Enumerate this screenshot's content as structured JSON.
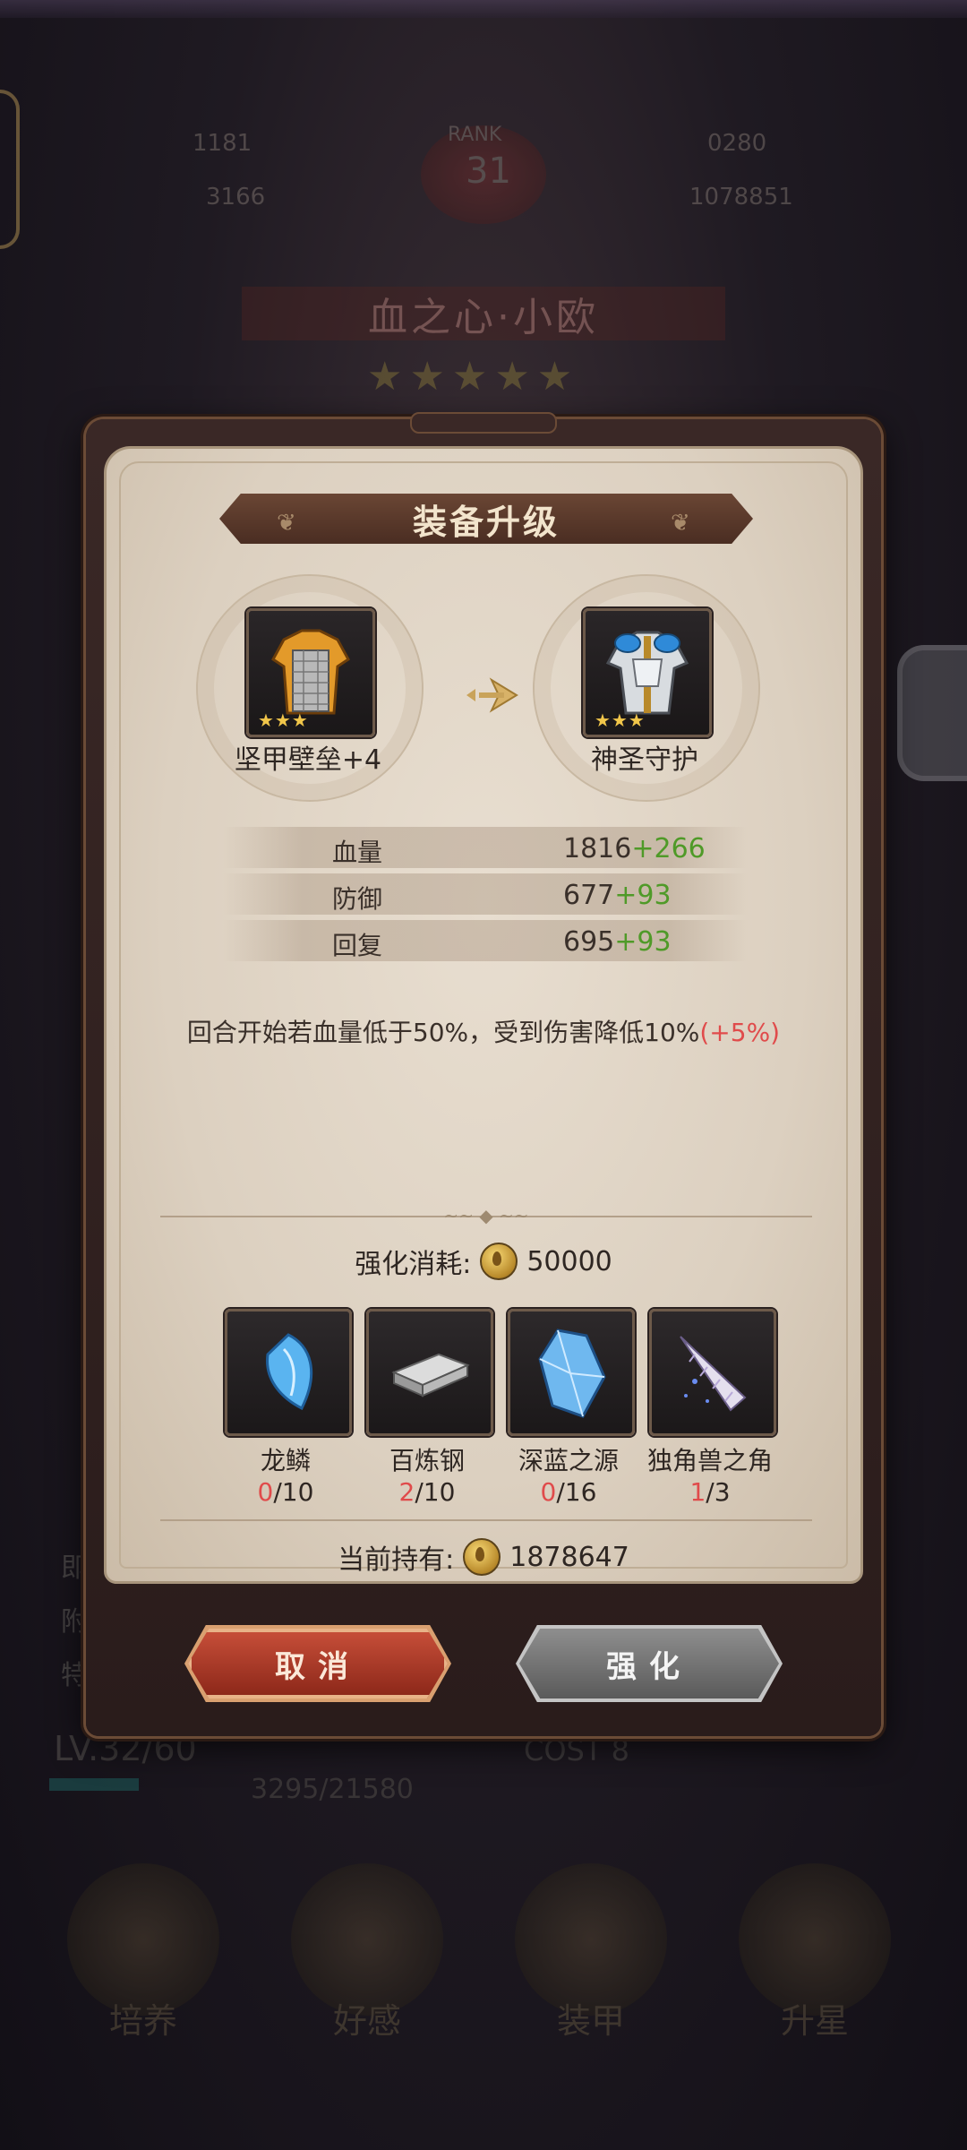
{
  "background": {
    "header_stats": [
      "1181",
      "RANK",
      "31",
      "0280",
      "3166",
      "1078851"
    ],
    "hero_name": "血之心·小欧",
    "hero_level": "LV.32/60",
    "cost": "COST 8",
    "exp": "3295/21580",
    "nav_labels": [
      "培养",
      "好感",
      "装甲",
      "升星"
    ]
  },
  "dialog": {
    "title": "装备升级",
    "current_item": {
      "name": "坚甲壁垒+4",
      "stars": "★★★",
      "icon": "chainmail-armor-icon"
    },
    "next_item": {
      "name": "神圣守护",
      "stars": "★★★",
      "icon": "holy-plate-armor-icon"
    },
    "stats": [
      {
        "label": "血量",
        "value": "1816",
        "bonus": "+266"
      },
      {
        "label": "防御",
        "value": "677",
        "bonus": "+93"
      },
      {
        "label": "回复",
        "value": "695",
        "bonus": "+93"
      }
    ],
    "effect": {
      "text": "回合开始若血量低于50%，受到伤害降低10%",
      "bonus": "(+5%)"
    },
    "cost": {
      "label": "强化消耗:",
      "amount": "50000",
      "icon": "gold-coin-icon"
    },
    "materials": [
      {
        "name": "龙鳞",
        "have": "0",
        "need": "/10",
        "icon": "dragon-scale-icon"
      },
      {
        "name": "百炼钢",
        "have": "2",
        "need": "/10",
        "icon": "steel-ingot-icon"
      },
      {
        "name": "深蓝之源",
        "have": "0",
        "need": "/16",
        "icon": "blue-crystal-icon"
      },
      {
        "name": "独角兽之角",
        "have": "1",
        "need": "/3",
        "icon": "unicorn-horn-icon"
      }
    ],
    "holding": {
      "label": "当前持有:",
      "amount": "1878647"
    },
    "buttons": {
      "cancel": "取消",
      "confirm": "强化"
    }
  },
  "colors": {
    "bonus_green": "#4f9a28",
    "bonus_red": "#e04b4b",
    "cancel_button": "#b23d28",
    "confirm_button": "#7a7a7a"
  }
}
